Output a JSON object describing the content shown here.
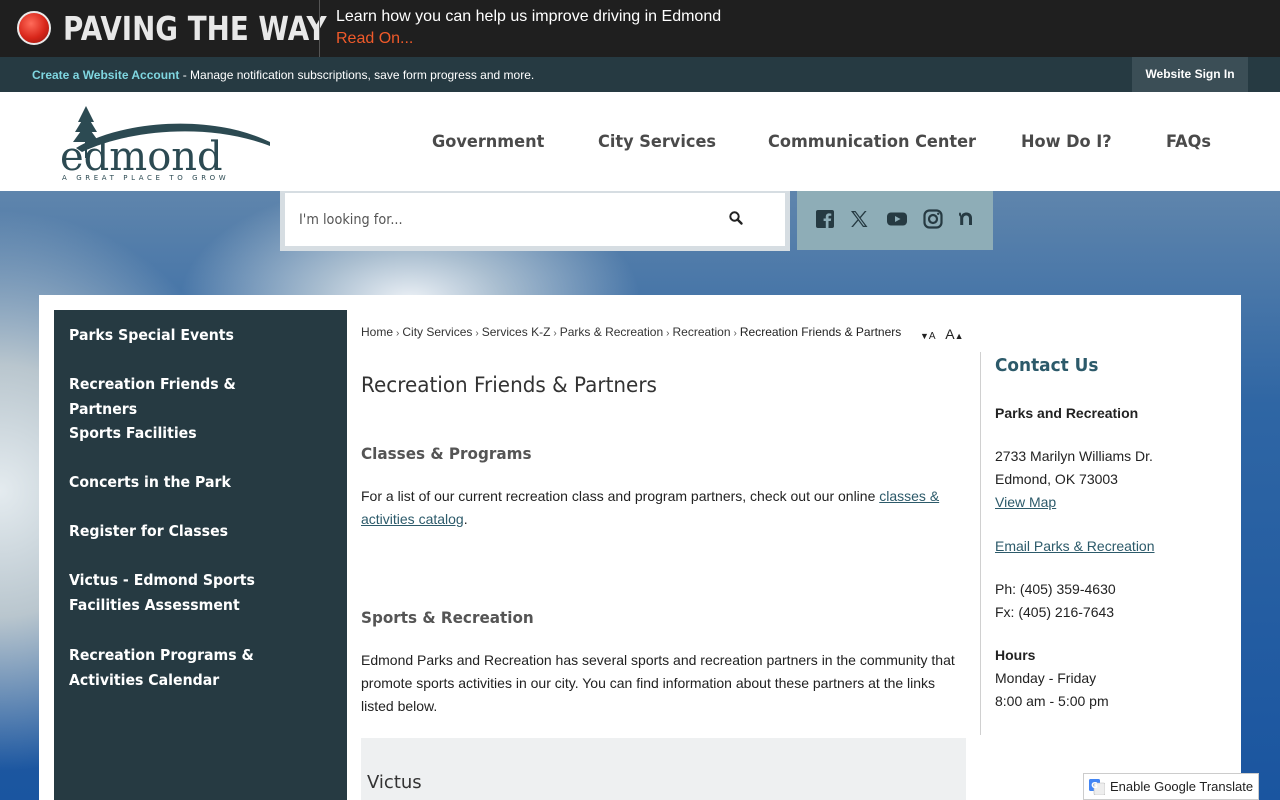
{
  "banner": {
    "title": "PAVING THE WAY",
    "message": "Learn how you can help us improve driving in Edmond",
    "link": "Read On..."
  },
  "account_bar": {
    "create_link": "Create a Website Account",
    "description": " - Manage notification subscriptions, save form progress and more.",
    "sign_in": "Website Sign In"
  },
  "logo": {
    "name": "edmond",
    "tagline": "A GREAT PLACE TO GROW"
  },
  "nav": [
    "Government",
    "City Services",
    "Communication Center",
    "How Do I?",
    "FAQs"
  ],
  "search": {
    "placeholder": "I'm looking for..."
  },
  "social": [
    "facebook-icon",
    "x-icon",
    "youtube-icon",
    "instagram-icon",
    "nextdoor-icon"
  ],
  "sidebar": {
    "items": [
      "Parks Special Events",
      "Recreation Friends & Partners",
      "Sports Facilities",
      "Concerts in the Park",
      "Register for Classes",
      "Victus - Edmond Sports Facilities Assessment",
      "Recreation Programs & Activities Calendar"
    ]
  },
  "breadcrumb": {
    "items": [
      "Home",
      "City Services",
      "Services K-Z",
      "Parks & Recreation",
      "Recreation"
    ],
    "current": "Recreation Friends & Partners"
  },
  "font_controls": {
    "decrease": "A",
    "increase": "A"
  },
  "content": {
    "title": "Recreation Friends & Partners",
    "section1_title": "Classes & Programs",
    "section1_text": "For a list of our current recreation class and program partners, check out our online ",
    "section1_link": "classes & activities catalog",
    "section1_end": ".",
    "section2_title": "Sports & Recreation",
    "section2_text": "Edmond Parks and Recreation has several sports and recreation partners in the community that promote sports activities in our city. You can find information about these partners at the links listed below.",
    "partner_title": "Victus"
  },
  "contact": {
    "title": "Contact Us",
    "department": "Parks and Recreation",
    "address1": "2733 Marilyn Williams Dr.",
    "address2": "Edmond, OK 73003",
    "map_link": "View Map",
    "email_link": "Email Parks & Recreation",
    "phone": "Ph: (405) 359-4630",
    "fax": "Fx: (405) 216-7643",
    "hours_label": "Hours",
    "hours_days": "Monday - Friday",
    "hours_time": "8:00 am - 5:00 pm"
  },
  "translate": {
    "label": "Enable Google Translate"
  },
  "colors": {
    "dark_teal": "#263a42",
    "accent_link": "#2c5a6a",
    "banner_red": "#f05a2a"
  }
}
